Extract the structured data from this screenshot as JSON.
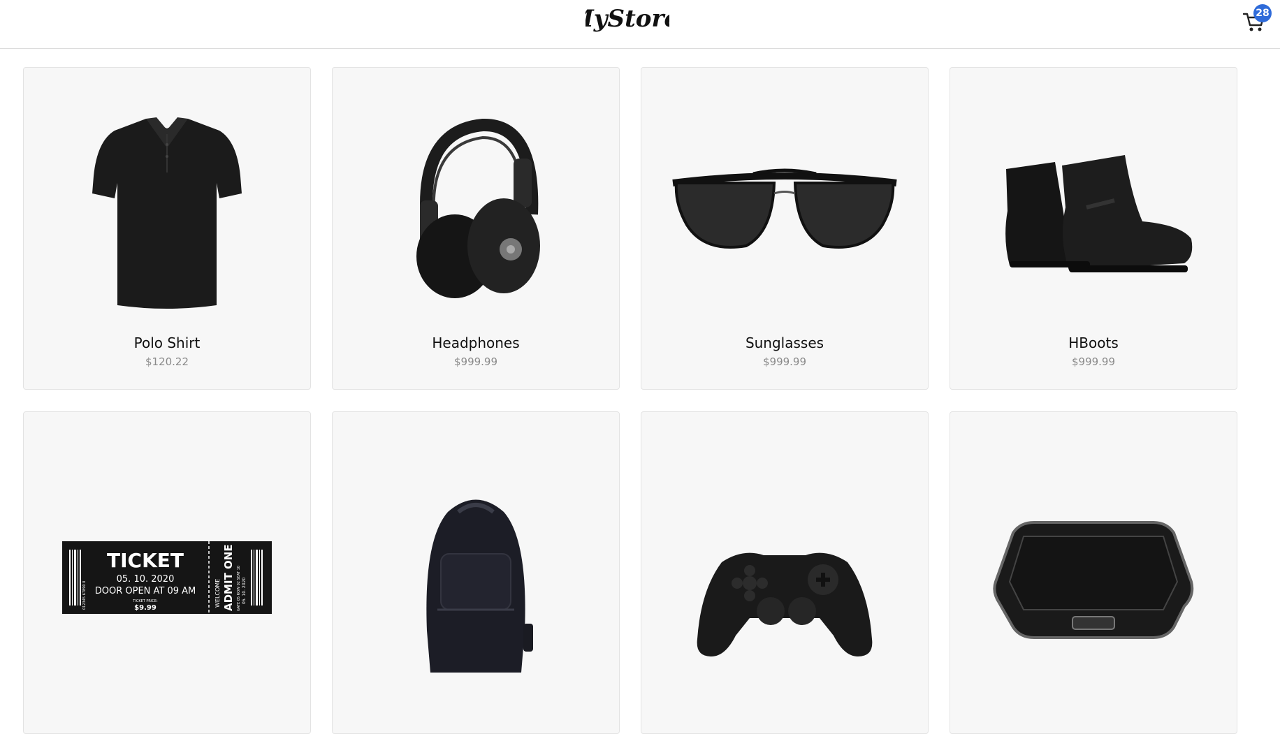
{
  "header": {
    "logo_text": "MyStore.",
    "cart_count": "28"
  },
  "products": [
    {
      "name": "Polo Shirt",
      "price": "$120.22",
      "icon": "polo-shirt"
    },
    {
      "name": "Headphones",
      "price": "$999.99",
      "icon": "headphones"
    },
    {
      "name": "Sunglasses",
      "price": "$999.99",
      "icon": "sunglasses"
    },
    {
      "name": "HBoots",
      "price": "$999.99",
      "icon": "boots"
    },
    {
      "name": "",
      "price": "",
      "icon": "ticket",
      "ticket": {
        "title": "TICKET",
        "date": "05. 10. 2020",
        "door": "DOOR OPEN AT 09 AM",
        "price_label": "TICKET PRICE:",
        "price": "$9.99",
        "stub_welcome": "WELCOME",
        "stub_admit": "ADMIT ONE",
        "stub_small": "GATE 05 ROW 02 SEAT 10",
        "stub_date": "05. 10. 2020",
        "barcode": "012345 67890 0"
      }
    },
    {
      "name": "",
      "price": "",
      "icon": "backpack"
    },
    {
      "name": "",
      "price": "",
      "icon": "gamepad"
    },
    {
      "name": "",
      "price": "",
      "icon": "food-container"
    }
  ]
}
